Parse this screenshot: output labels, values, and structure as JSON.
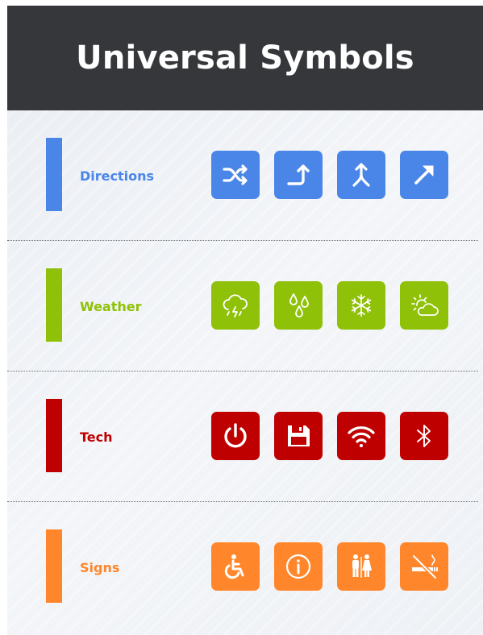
{
  "title": "Universal Symbols",
  "categories": [
    {
      "label": "Directions",
      "color": "#4a86e8",
      "icons": [
        "shuffle-icon",
        "turn-up-right-icon",
        "merge-icon",
        "arrow-up-right-icon"
      ]
    },
    {
      "label": "Weather",
      "color": "#8fc108",
      "icons": [
        "storm-cloud-icon",
        "rain-drops-icon",
        "snowflake-icon",
        "partly-sunny-icon"
      ]
    },
    {
      "label": "Tech",
      "color": "#bf0000",
      "icons": [
        "power-icon",
        "floppy-disk-icon",
        "wifi-icon",
        "bluetooth-icon"
      ]
    },
    {
      "label": "Signs",
      "color": "#ff862a",
      "icons": [
        "wheelchair-icon",
        "info-icon",
        "restroom-icon",
        "no-smoking-icon"
      ]
    }
  ]
}
